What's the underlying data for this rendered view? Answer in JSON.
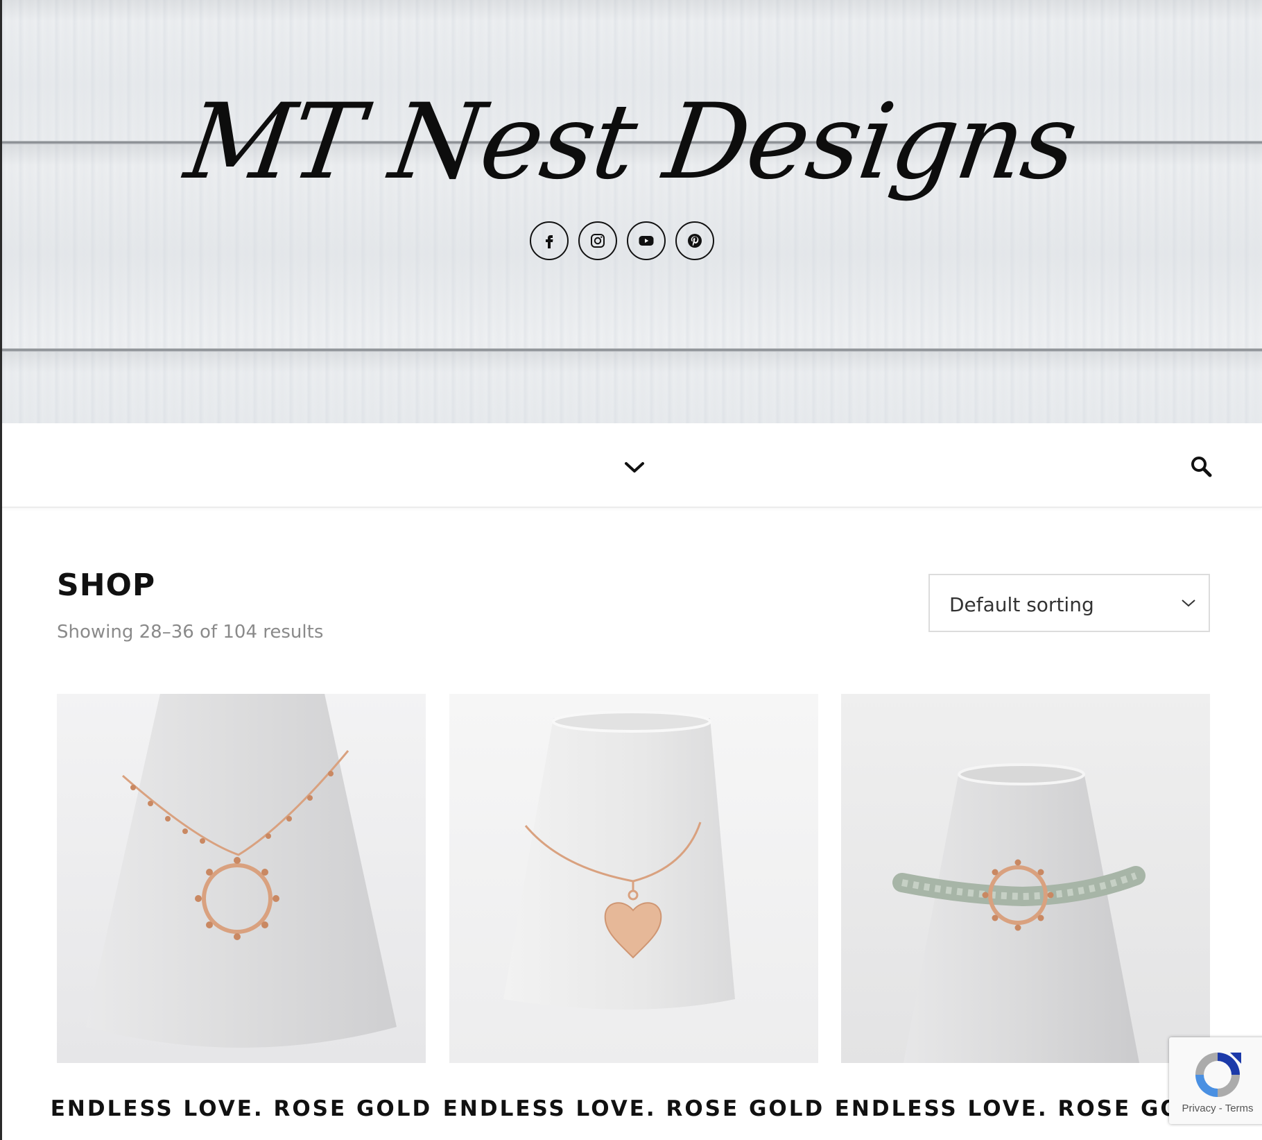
{
  "site": {
    "logo_text": "MT Nest Designs"
  },
  "social": [
    {
      "name": "facebook-icon"
    },
    {
      "name": "instagram-icon"
    },
    {
      "name": "youtube-icon"
    },
    {
      "name": "pinterest-icon"
    }
  ],
  "nav": {
    "menu_icon": "chevron-down-icon",
    "search_icon": "search-icon"
  },
  "shop": {
    "title": "SHOP",
    "result_count": "Showing 28–36 of 104 results",
    "sorting": {
      "selected": "Default sorting"
    }
  },
  "products": [
    {
      "name": "ENDLESS LOVE. ROSE GOLD"
    },
    {
      "name": "ENDLESS LOVE. ROSE GOLD"
    },
    {
      "name": "ENDLESS LOVE. ROSE GOLD"
    }
  ],
  "recaptcha": {
    "privacy": "Privacy",
    "separator": " - ",
    "terms": "Terms"
  },
  "colors": {
    "text": "#111111",
    "muted": "#8a8a8a",
    "rose_gold": "#d9a17f"
  }
}
